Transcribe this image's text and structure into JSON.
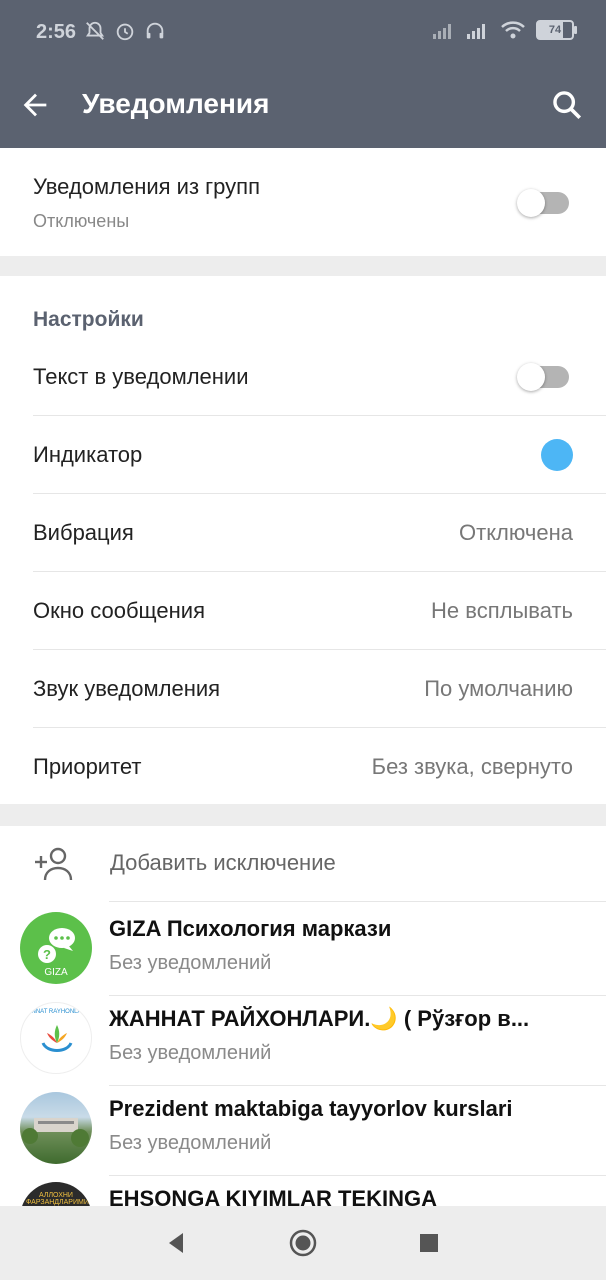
{
  "status_bar": {
    "time": "2:56",
    "battery": "74",
    "icons": [
      "bell-off-icon",
      "alarm-icon",
      "headset-icon",
      "signal-icon",
      "signal-icon",
      "wifi-icon",
      "battery-icon"
    ]
  },
  "app_bar": {
    "title": "Уведомления",
    "back_icon": "arrow-left-icon",
    "search_icon": "search-icon"
  },
  "group_notifications": {
    "label": "Уведомления из групп",
    "sub": "Отключены",
    "enabled": false
  },
  "settings": {
    "header": "Настройки",
    "items": [
      {
        "label": "Текст в уведомлении",
        "type": "toggle",
        "enabled": false
      },
      {
        "label": "Индикатор",
        "type": "color",
        "color": "#4db6f5"
      },
      {
        "label": "Вибрация",
        "type": "value",
        "value": "Отключена"
      },
      {
        "label": "Окно сообщения",
        "type": "value",
        "value": "Не всплывать"
      },
      {
        "label": "Звук уведомления",
        "type": "value",
        "value": "По умолчанию"
      },
      {
        "label": "Приоритет",
        "type": "value",
        "value": "Без звука, свернуто"
      }
    ]
  },
  "exceptions": {
    "add_label": "Добавить исключение",
    "chats": [
      {
        "name": "GIZA Психология маркази",
        "sub": "Без уведомлений",
        "avatar_text": "GIZA"
      },
      {
        "name": "ЖАННАТ РАЙХОНЛАРИ.🌙 ( Рўзғор в...",
        "sub": "Без уведомлений",
        "avatar_text": "JANNAT RAYHONLARI"
      },
      {
        "name": "Prezident maktabiga tayyorlov kurslari",
        "sub": "Без уведомлений",
        "avatar_text": ""
      },
      {
        "name": "EHSONGA KIYIMLAR TEKINGA",
        "sub": "",
        "avatar_text": "АЛЛОХНИ ФАРЗАНДЛАРИМИ"
      }
    ]
  },
  "colors": {
    "app_bar": "#5b6270",
    "accent": "#4db6f5",
    "giza_green": "#5cc04a"
  }
}
